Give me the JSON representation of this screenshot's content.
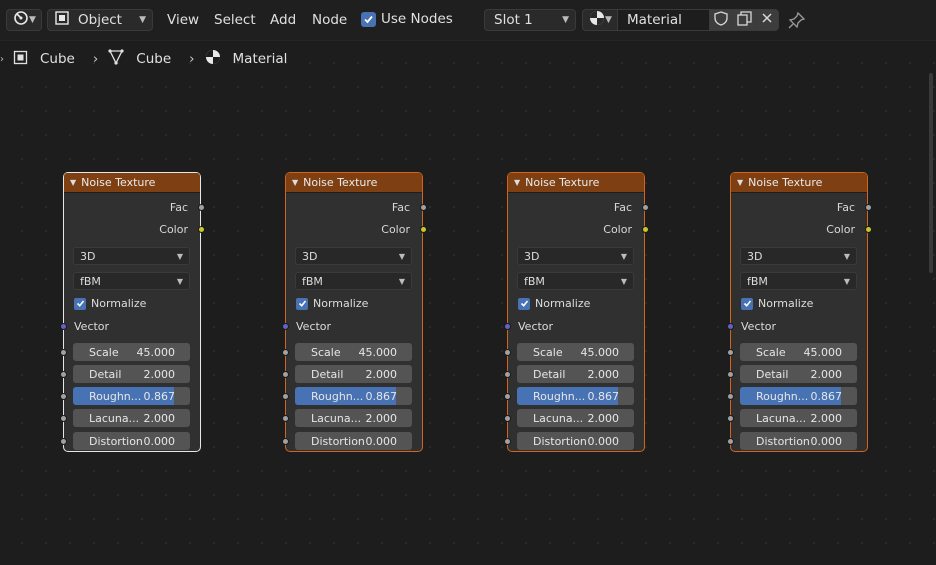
{
  "header": {
    "editor_type_icon": "node-editor-icon",
    "mode": {
      "icon": "object-mode-icon",
      "label": "Object"
    },
    "menus": [
      "View",
      "Select",
      "Add",
      "Node"
    ],
    "use_nodes": {
      "label": "Use Nodes",
      "checked": true
    },
    "slot": {
      "label": "Slot 1"
    },
    "material": {
      "icon": "material-sphere-icon",
      "name": "Material"
    },
    "icons": [
      "fake-user-shield-icon",
      "duplicate-icon",
      "close-icon",
      "pin-icon"
    ]
  },
  "breadcrumb": [
    {
      "icon": "object-icon",
      "label": "Cube"
    },
    {
      "icon": "mesh-data-icon",
      "label": "Cube"
    },
    {
      "icon": "material-sphere-icon",
      "label": "Material"
    }
  ],
  "nodes": [
    {
      "title": "Noise Texture",
      "active": true,
      "outputs": [
        "Fac",
        "Color"
      ],
      "dimensions": "3D",
      "type": "fBM",
      "normalize_label": "Normalize",
      "normalize": true,
      "vector_label": "Vector",
      "fields": [
        {
          "label": "Scale",
          "value": "45.000"
        },
        {
          "label": "Detail",
          "value": "2.000"
        },
        {
          "label": "Roughn...",
          "value": "0.867",
          "fill_fraction": 0.867
        },
        {
          "label": "Lacuna...",
          "value": "2.000"
        },
        {
          "label": "Distortion",
          "value": "0.000"
        }
      ]
    },
    {
      "title": "Noise Texture",
      "active": false,
      "outputs": [
        "Fac",
        "Color"
      ],
      "dimensions": "3D",
      "type": "fBM",
      "normalize_label": "Normalize",
      "normalize": true,
      "vector_label": "Vector",
      "fields": [
        {
          "label": "Scale",
          "value": "45.000"
        },
        {
          "label": "Detail",
          "value": "2.000"
        },
        {
          "label": "Roughn...",
          "value": "0.867",
          "fill_fraction": 0.867
        },
        {
          "label": "Lacuna...",
          "value": "2.000"
        },
        {
          "label": "Distortion",
          "value": "0.000"
        }
      ]
    },
    {
      "title": "Noise Texture",
      "active": false,
      "outputs": [
        "Fac",
        "Color"
      ],
      "dimensions": "3D",
      "type": "fBM",
      "normalize_label": "Normalize",
      "normalize": true,
      "vector_label": "Vector",
      "fields": [
        {
          "label": "Scale",
          "value": "45.000"
        },
        {
          "label": "Detail",
          "value": "2.000"
        },
        {
          "label": "Roughn...",
          "value": "0.867",
          "fill_fraction": 0.867
        },
        {
          "label": "Lacuna...",
          "value": "2.000"
        },
        {
          "label": "Distortion",
          "value": "0.000"
        }
      ]
    },
    {
      "title": "Noise Texture",
      "active": false,
      "outputs": [
        "Fac",
        "Color"
      ],
      "dimensions": "3D",
      "type": "fBM",
      "normalize_label": "Normalize",
      "normalize": true,
      "vector_label": "Vector",
      "fields": [
        {
          "label": "Scale",
          "value": "45.000"
        },
        {
          "label": "Detail",
          "value": "2.000"
        },
        {
          "label": "Roughn...",
          "value": "0.867",
          "fill_fraction": 0.867
        },
        {
          "label": "Lacuna...",
          "value": "2.000"
        },
        {
          "label": "Distortion",
          "value": "0.000"
        }
      ]
    }
  ],
  "colors": {
    "node_header": "#7e4012",
    "node_border_selected": "#d2641e",
    "node_border_active": "#e6e6e6",
    "socket_float": "#a1a1a1",
    "socket_color": "#c7c729",
    "socket_vector": "#6363c7",
    "accent": "#4772b3"
  }
}
